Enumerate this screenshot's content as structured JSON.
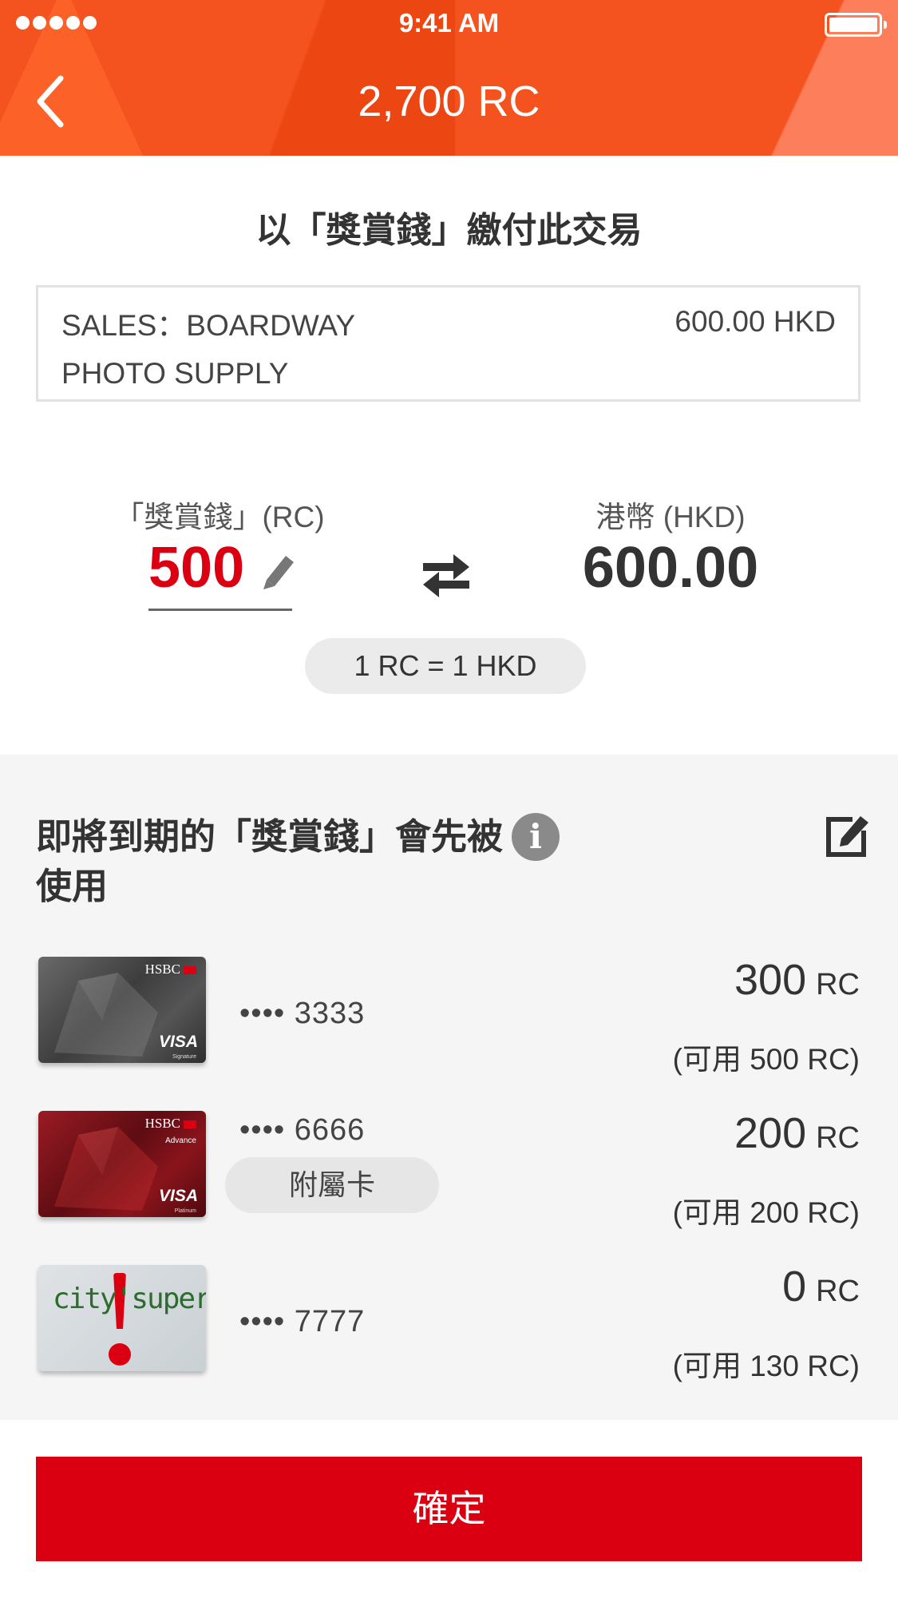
{
  "status_bar": {
    "time": "9:41 AM"
  },
  "nav": {
    "title": "2,700 RC"
  },
  "section_title": "以「獎賞錢」繳付此交易",
  "transaction": {
    "merchant": "SALES：BOARDWAY PHOTO SUPPLY",
    "amount": "600.00 HKD"
  },
  "conversion": {
    "rc_label": "「獎賞錢」(RC)",
    "rc_value": "500",
    "hkd_label": "港幣 (HKD)",
    "hkd_value": "600.00",
    "rate": "1 RC = 1 HKD"
  },
  "expire_section": {
    "title": "即將到期的「獎賞錢」會先被使用"
  },
  "cards": [
    {
      "number": "•••• 3333",
      "amount": "300",
      "unit": "RC",
      "available": "(可用 500 RC)"
    },
    {
      "number": "•••• 6666",
      "tag": "附屬卡",
      "amount": "200",
      "unit": "RC",
      "available": "(可用 200 RC)"
    },
    {
      "number": "•••• 7777",
      "amount": "0",
      "unit": "RC",
      "available": "(可用 130 RC)"
    }
  ],
  "card_logos": {
    "hsbc": "HSBC",
    "advance": "Advance",
    "visa": "VISA",
    "signature": "Signature",
    "platinum": "Platinum",
    "citysuper": "city'super"
  },
  "confirm_label": "確定",
  "colors": {
    "header": "#f4521e",
    "accent_red": "#db0011",
    "gray_bg": "#f5f5f5"
  },
  "icons": [
    "signal-icon",
    "battery-icon",
    "back-arrow-icon",
    "pencil-icon",
    "swap-icon",
    "info-icon",
    "edit-icon"
  ]
}
